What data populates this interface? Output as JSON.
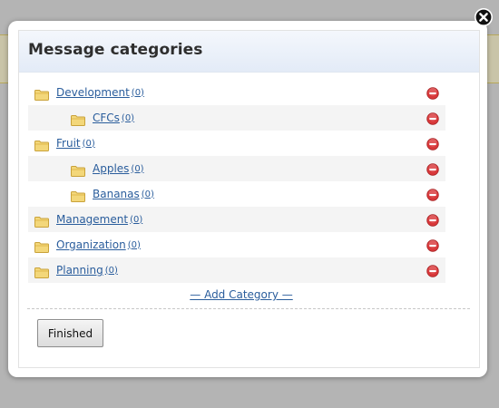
{
  "dialog": {
    "title": "Message categories",
    "close_icon": "close-icon",
    "finished_label": "Finished",
    "add_category_label": "— Add Category —"
  },
  "categories": [
    {
      "name": "Development",
      "count": "(0)",
      "level": 0,
      "shaded": false
    },
    {
      "name": "CFCs",
      "count": "(0)",
      "level": 1,
      "shaded": true
    },
    {
      "name": "Fruit",
      "count": "(0)",
      "level": 0,
      "shaded": false
    },
    {
      "name": "Apples",
      "count": "(0)",
      "level": 1,
      "shaded": true
    },
    {
      "name": "Bananas",
      "count": "(0)",
      "level": 1,
      "shaded": false
    },
    {
      "name": "Management",
      "count": "(0)",
      "level": 0,
      "shaded": true
    },
    {
      "name": "Organization",
      "count": "(0)",
      "level": 0,
      "shaded": false
    },
    {
      "name": "Planning",
      "count": "(0)",
      "level": 0,
      "shaded": true
    }
  ],
  "icons": {
    "folder": "folder-icon",
    "delete": "delete-icon"
  },
  "colors": {
    "link": "#2a5d9c",
    "delete_red": "#d9383a",
    "folder_yellow": "#f3d77a",
    "header_bg": "#e3ebf7",
    "overlay": "#b4b4b4"
  }
}
